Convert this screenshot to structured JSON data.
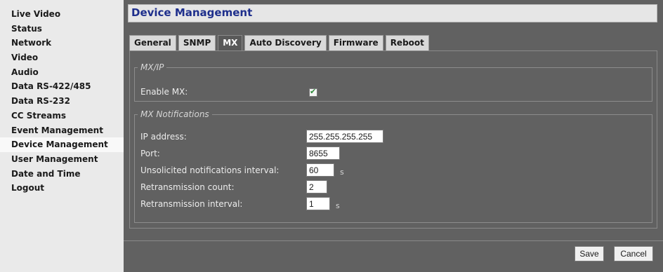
{
  "sidebar": {
    "items": [
      {
        "label": "Live Video"
      },
      {
        "label": "Status"
      },
      {
        "label": "Network"
      },
      {
        "label": "Video"
      },
      {
        "label": "Audio"
      },
      {
        "label": "Data RS-422/485"
      },
      {
        "label": "Data RS-232"
      },
      {
        "label": "CC Streams"
      },
      {
        "label": "Event Management"
      },
      {
        "label": "Device Management"
      },
      {
        "label": "User Management"
      },
      {
        "label": "Date and Time"
      },
      {
        "label": "Logout"
      }
    ],
    "active": "Device Management"
  },
  "header": {
    "title": "Device Management"
  },
  "tabs": [
    {
      "label": "General"
    },
    {
      "label": "SNMP"
    },
    {
      "label": "MX"
    },
    {
      "label": "Auto Discovery"
    },
    {
      "label": "Firmware"
    },
    {
      "label": "Reboot"
    }
  ],
  "active_tab": "MX",
  "mxip": {
    "legend": "MX/IP",
    "enable_label": "Enable MX:",
    "enable_checked": true
  },
  "notifications": {
    "legend": "MX Notifications",
    "ip_label": "IP address:",
    "ip_value": "255.255.255.255",
    "port_label": "Port:",
    "port_value": "8655",
    "interval_label": "Unsolicited notifications interval:",
    "interval_value": "60",
    "interval_unit": "s",
    "retrans_count_label": "Retransmission count:",
    "retrans_count_value": "2",
    "retrans_interval_label": "Retransmission interval:",
    "retrans_interval_value": "1",
    "retrans_interval_unit": "s"
  },
  "buttons": {
    "save": "Save",
    "cancel": "Cancel"
  }
}
